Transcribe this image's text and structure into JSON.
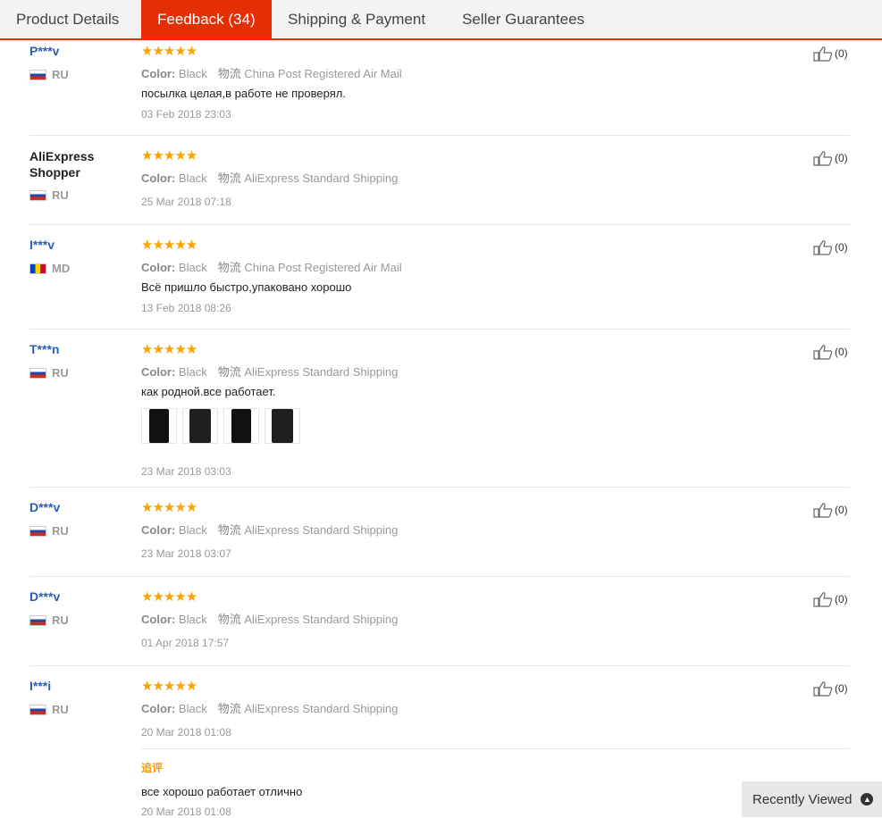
{
  "tabs": [
    {
      "label": "Product Details",
      "active": false
    },
    {
      "label": "Feedback (34)",
      "active": true
    },
    {
      "label": "Shipping & Payment",
      "active": false
    },
    {
      "label": "Seller Guarantees",
      "active": false
    }
  ],
  "reviews": [
    {
      "user": "P***v",
      "country": "RU",
      "rating": 5,
      "color_label": "Color:",
      "color": "Black",
      "ship_label": "物流",
      "shipping": "China Post Registered Air Mail",
      "comment": "посылка целая,в работе не проверял.",
      "date": "03 Feb 2018 23:03",
      "helpful": "(0)"
    },
    {
      "user": "AliExpress Shopper",
      "country": "RU",
      "rating": 5,
      "color_label": "Color:",
      "color": "Black",
      "ship_label": "物流",
      "shipping": "AliExpress Standard Shipping",
      "comment": "",
      "date": "25 Mar 2018 07:18",
      "helpful": "(0)"
    },
    {
      "user": "I***v",
      "country": "MD",
      "rating": 5,
      "color_label": "Color:",
      "color": "Black",
      "ship_label": "物流",
      "shipping": "China Post Registered Air Mail",
      "comment": "Всё пришло быстро,упаковано хорошо",
      "date": "13 Feb 2018 08:26",
      "helpful": "(0)"
    },
    {
      "user": "T***n",
      "country": "RU",
      "rating": 5,
      "color_label": "Color:",
      "color": "Black",
      "ship_label": "物流",
      "shipping": "AliExpress Standard Shipping",
      "comment": "как родной.все работает.",
      "date": "23 Mar 2018 03:03",
      "helpful": "(0)"
    },
    {
      "user": "D***v",
      "country": "RU",
      "rating": 5,
      "color_label": "Color:",
      "color": "Black",
      "ship_label": "物流",
      "shipping": "AliExpress Standard Shipping",
      "comment": "",
      "date": "23 Mar 2018 03:07",
      "helpful": "(0)"
    },
    {
      "user": "D***v",
      "country": "RU",
      "rating": 5,
      "color_label": "Color:",
      "color": "Black",
      "ship_label": "物流",
      "shipping": "AliExpress Standard Shipping",
      "comment": "",
      "date": "01 Apr 2018 17:57",
      "helpful": "(0)"
    },
    {
      "user": "I***i",
      "country": "RU",
      "rating": 5,
      "color_label": "Color:",
      "color": "Black",
      "ship_label": "物流",
      "shipping": "AliExpress Standard Shipping",
      "comment": "",
      "date": "20 Mar 2018 01:08",
      "helpful": "(0)",
      "additional": {
        "label": "追评",
        "comment": "все хорошо работает отлично",
        "date": "20 Mar 2018 01:08"
      }
    }
  ],
  "stars": "★★★★★",
  "recently_viewed": {
    "label": "Recently Viewed",
    "icon": "chevron-up-icon"
  },
  "colors": {
    "accent": "#e62e04",
    "star": "#f7a300",
    "username": "#2b5db4"
  }
}
